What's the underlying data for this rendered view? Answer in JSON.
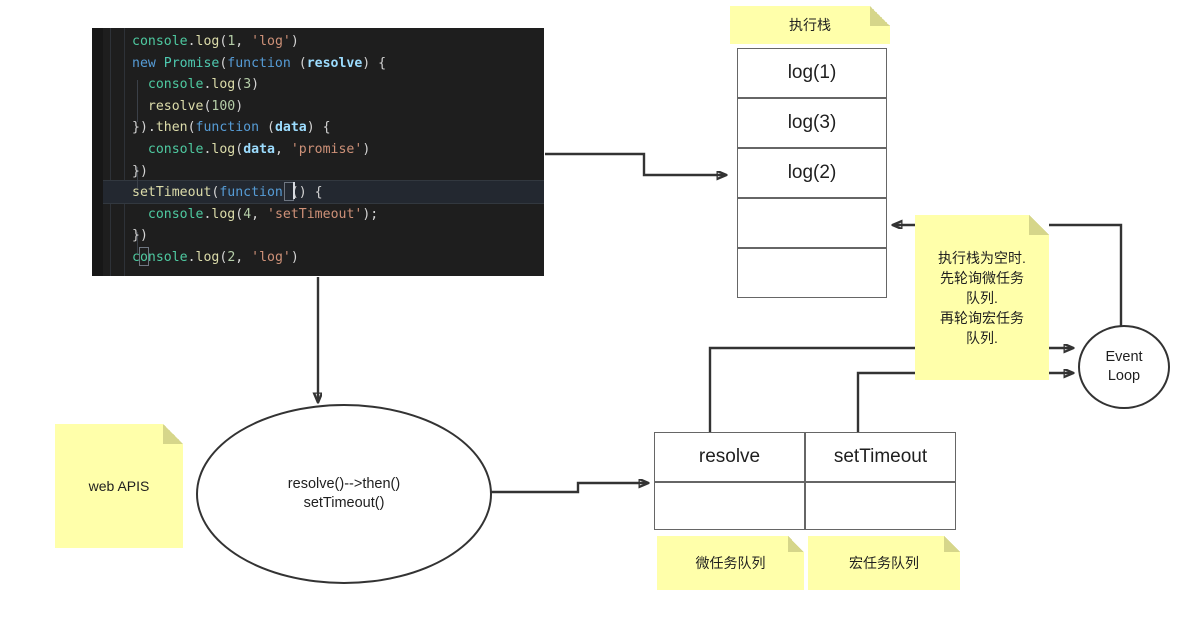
{
  "code_panel": {
    "name": "javascript-source-code",
    "lines": [
      [
        {
          "t": "console",
          "c": "obj"
        },
        {
          "t": ".",
          "c": "pun"
        },
        {
          "t": "log",
          "c": "fn"
        },
        {
          "t": "(",
          "c": "pun"
        },
        {
          "t": "1",
          "c": "num"
        },
        {
          "t": ", ",
          "c": "pun"
        },
        {
          "t": "'log'",
          "c": "str"
        },
        {
          "t": ")",
          "c": "pun"
        }
      ],
      [
        {
          "t": "new ",
          "c": "kw"
        },
        {
          "t": "Promise",
          "c": "cls"
        },
        {
          "t": "(",
          "c": "pun"
        },
        {
          "t": "function",
          "c": "kw"
        },
        {
          "t": " (",
          "c": "pun"
        },
        {
          "t": "resolve",
          "c": "var"
        },
        {
          "t": ") {",
          "c": "pun"
        }
      ],
      [
        {
          "t": "  ",
          "c": "pun"
        },
        {
          "t": "console",
          "c": "obj"
        },
        {
          "t": ".",
          "c": "pun"
        },
        {
          "t": "log",
          "c": "fn"
        },
        {
          "t": "(",
          "c": "pun"
        },
        {
          "t": "3",
          "c": "num"
        },
        {
          "t": ")",
          "c": "pun"
        }
      ],
      [
        {
          "t": "  ",
          "c": "pun"
        },
        {
          "t": "resolve",
          "c": "fn"
        },
        {
          "t": "(",
          "c": "pun"
        },
        {
          "t": "100",
          "c": "num"
        },
        {
          "t": ")",
          "c": "pun"
        }
      ],
      [
        {
          "t": "}).",
          "c": "pun"
        },
        {
          "t": "then",
          "c": "fn"
        },
        {
          "t": "(",
          "c": "pun"
        },
        {
          "t": "function",
          "c": "kw"
        },
        {
          "t": " (",
          "c": "pun"
        },
        {
          "t": "data",
          "c": "var"
        },
        {
          "t": ") {",
          "c": "pun"
        }
      ],
      [
        {
          "t": "  ",
          "c": "pun"
        },
        {
          "t": "console",
          "c": "obj"
        },
        {
          "t": ".",
          "c": "pun"
        },
        {
          "t": "log",
          "c": "fn"
        },
        {
          "t": "(",
          "c": "pun"
        },
        {
          "t": "data",
          "c": "var"
        },
        {
          "t": ", ",
          "c": "pun"
        },
        {
          "t": "'promise'",
          "c": "str"
        },
        {
          "t": ")",
          "c": "pun"
        }
      ],
      [
        {
          "t": "})",
          "c": "pun"
        }
      ],
      [
        {
          "t": "setTimeout",
          "c": "fn"
        },
        {
          "t": "(",
          "c": "pun"
        },
        {
          "t": "function",
          "c": "kw"
        },
        {
          "t": " () ",
          "c": "pun"
        },
        {
          "t": "{",
          "c": "pun"
        }
      ],
      [
        {
          "t": "  ",
          "c": "pun"
        },
        {
          "t": "console",
          "c": "obj"
        },
        {
          "t": ".",
          "c": "pun"
        },
        {
          "t": "log",
          "c": "fn"
        },
        {
          "t": "(",
          "c": "pun"
        },
        {
          "t": "4",
          "c": "num"
        },
        {
          "t": ", ",
          "c": "pun"
        },
        {
          "t": "'setTimeout'",
          "c": "str"
        },
        {
          "t": ");",
          "c": "pun"
        }
      ],
      [
        {
          "t": "})",
          "c": "pun"
        }
      ],
      [
        {
          "t": "console",
          "c": "obj"
        },
        {
          "t": ".",
          "c": "pun"
        },
        {
          "t": "log",
          "c": "fn"
        },
        {
          "t": "(",
          "c": "pun"
        },
        {
          "t": "2",
          "c": "num"
        },
        {
          "t": ", ",
          "c": "pun"
        },
        {
          "t": "'log'",
          "c": "str"
        },
        {
          "t": ")",
          "c": "pun"
        }
      ]
    ],
    "plain_text": "console.log(1, 'log')\nnew Promise(function (resolve) {\n  console.log(3)\n  resolve(100)\n}).then(function (data) {\n  console.log(data, 'promise')\n})\nsetTimeout(function () {\n  console.log(4, 'setTimeout');\n})\nconsole.log(2, 'log')"
  },
  "call_stack": {
    "note_label": "执行栈",
    "frames": [
      "log(1)",
      "log(3)",
      "log(2)",
      "",
      ""
    ]
  },
  "event_loop_note": {
    "text": "执行栈为空时.\n先轮询微任务队列.\n再轮询宏任务队列.",
    "lines": [
      "执行栈为空时.",
      "先轮询微任务",
      "队列.",
      "再轮询宏任务",
      "队列."
    ]
  },
  "event_loop": {
    "line1": "Event",
    "line2": "Loop"
  },
  "web_apis_note": {
    "label": "web APIS"
  },
  "async_ellipse": {
    "line1": "resolve()-->then()",
    "line2": "setTimeout()"
  },
  "queues": {
    "microtask": {
      "head": "resolve",
      "empty_slot": "",
      "note_label": "微任务队列"
    },
    "macrotask": {
      "head": "setTimeout",
      "empty_slot": "",
      "note_label": "宏任务队列"
    }
  },
  "colors": {
    "note_bg": "#ffffaa",
    "note_fold": "#d6d68a",
    "stroke": "#333333",
    "box_border": "#666666",
    "code_bg": "#1e1e1e",
    "code_gutter": "#171717"
  }
}
